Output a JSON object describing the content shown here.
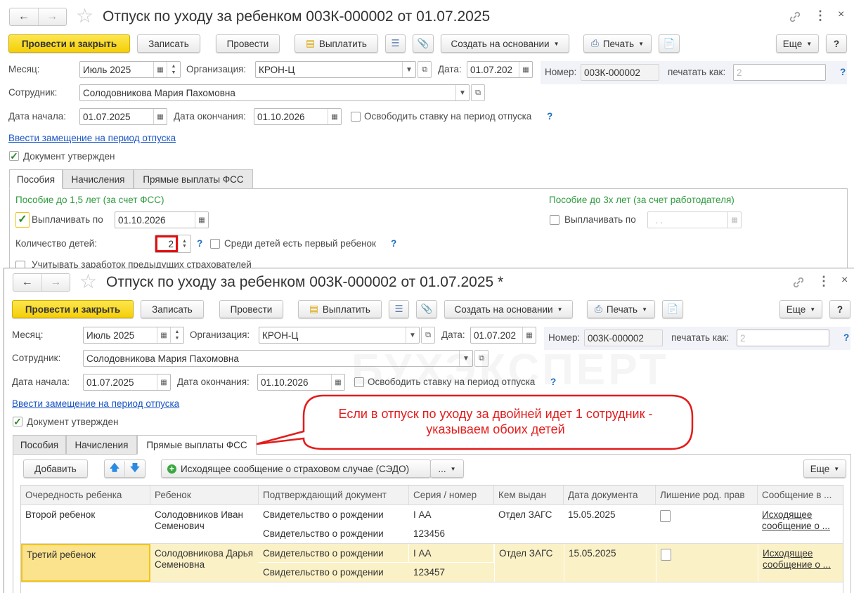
{
  "windows": {
    "back": {
      "title": "Отпуск по уходу за ребенком 003К-000002 от 01.07.2025"
    },
    "front": {
      "title": "Отпуск по уходу за ребенком 003К-000002 от 01.07.2025 *"
    }
  },
  "toolbar": {
    "post_close": "Провести и закрыть",
    "save": "Записать",
    "post": "Провести",
    "pay": "Выплатить",
    "create_based": "Создать на основании",
    "print": "Печать",
    "more": "Еще",
    "help": "?"
  },
  "form": {
    "month_label": "Месяц:",
    "month": "Июль 2025",
    "org_label": "Организация:",
    "org": "КРОН-Ц",
    "date_label": "Дата:",
    "date": "01.07.202",
    "number_label": "Номер:",
    "number": "003К-000002",
    "print_as_label": "печатать как:",
    "print_as": "2",
    "employee_label": "Сотрудник:",
    "employee": "Солодовникова Мария Пахомовна",
    "start_label": "Дата начала:",
    "start": "01.07.2025",
    "end_label": "Дата окончания:",
    "end": "01.10.2026",
    "free_rate_label": "Освободить ставку на период отпуска",
    "substitution_link": "Ввести замещение на период отпуска",
    "approved_label": "Документ утвержден",
    "help": "?"
  },
  "tabs": [
    "Пособия",
    "Начисления",
    "Прямые выплаты ФСС"
  ],
  "benefits": {
    "left_title": "Пособие до 1,5 лет (за счет ФСС)",
    "right_title": "Пособие до 3х лет (за счет работодателя)",
    "pay_until_label": "Выплачивать по",
    "pay_until": "01.10.2026",
    "pay_until_3y": ". .",
    "children_count_label": "Количество детей:",
    "children_count": "2",
    "first_child_label": "Среди детей есть первый ребенок",
    "prev_earnings_label": "Учитывать заработок предыдущих страхователей"
  },
  "fss": {
    "add": "Добавить",
    "message_button": "Исходящее сообщение о страховом случае (СЭДО)",
    "dots": "...",
    "more": "Еще",
    "columns": [
      "Очередность ребенка",
      "Ребенок",
      "Подтверждающий документ",
      "Серия / номер",
      "Кем выдан",
      "Дата документа",
      "Лишение род. прав",
      "Сообщение в ..."
    ],
    "rows": [
      {
        "order": "Второй ребенок",
        "child": "Солодовников Иван Семенович",
        "doc1": "Свидетельство о рождении",
        "doc2": "Свидетельство о рождении",
        "series": "I АА",
        "number": "123456",
        "issuer": "Отдел ЗАГС",
        "date": "15.05.2025",
        "message": "Исходящее сообщение о ..."
      },
      {
        "order": "Третий ребенок",
        "child": "Солодовникова Дарья Семеновна",
        "doc1": "Свидетельство о рождении",
        "doc2": "Свидетельство о рождении",
        "series": "I АА",
        "number": "123457",
        "issuer": "Отдел ЗАГС",
        "date": "15.05.2025",
        "message": "Исходящее сообщение о ..."
      }
    ]
  },
  "callout": {
    "text": "Если в отпуск по уходу за двойней идет 1 сотрудник - указываем обоих детей",
    "color": "#e31c1c"
  },
  "watermark": "БУХЭКСПЕРТ"
}
